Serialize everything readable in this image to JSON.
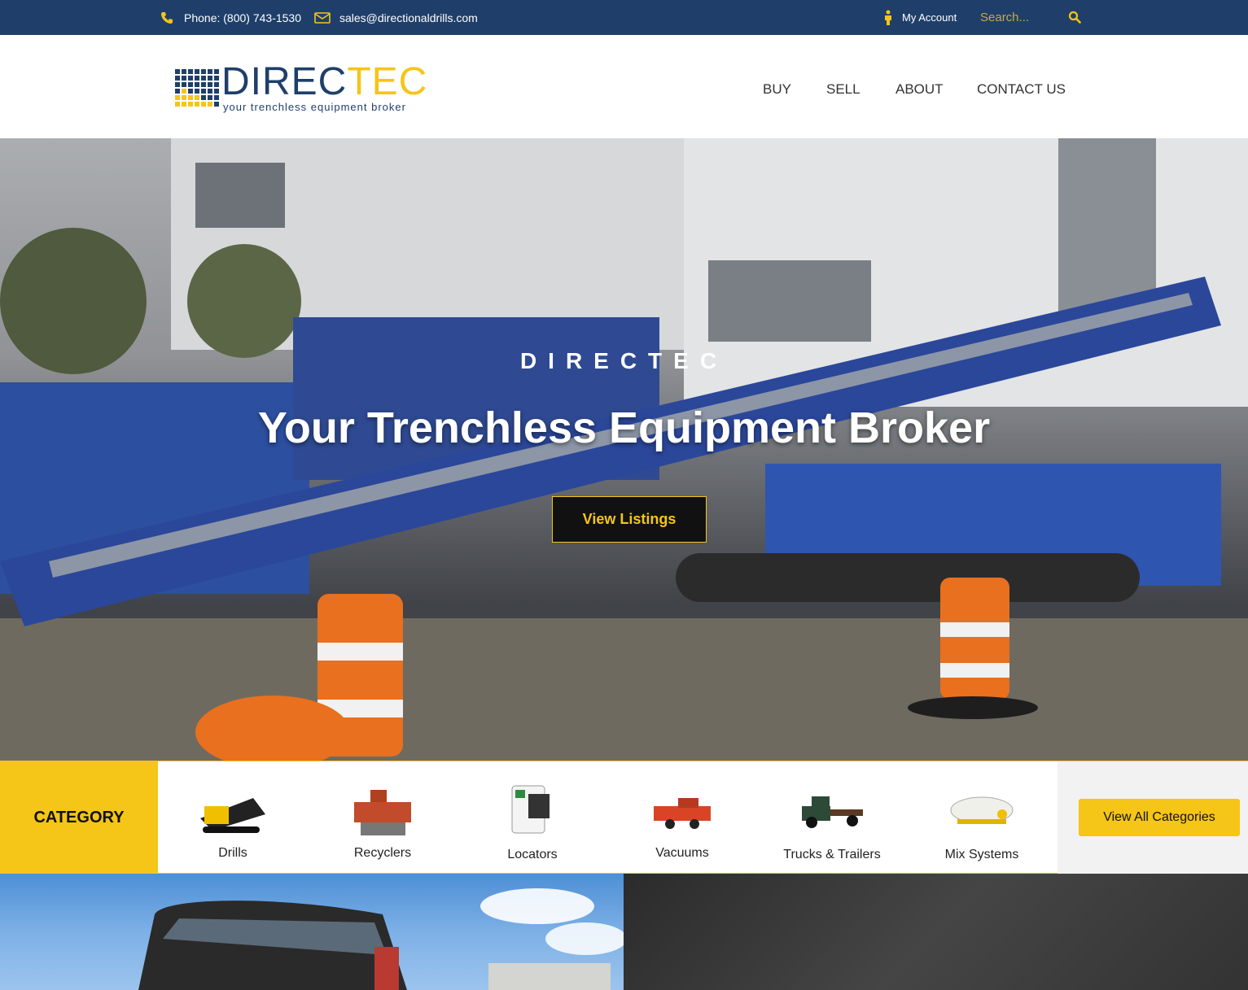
{
  "topbar": {
    "phone": "Phone: (800) 743-1530",
    "email": "sales@directionaldrills.com",
    "account": "My Account",
    "search_placeholder": "Search...",
    "icons": [
      "phone-icon",
      "envelope-icon",
      "user-icon",
      "search-icon"
    ]
  },
  "header": {
    "logo_part1": "DIREC",
    "logo_part2": "TEC",
    "logo_tagline": "your trenchless equipment broker",
    "nav": [
      "BUY",
      "SELL",
      "ABOUT",
      "CONTACT US"
    ]
  },
  "hero": {
    "brand": "DIRECTEC",
    "headline": "Your Trenchless Equipment Broker",
    "cta": "View Listings"
  },
  "categories": {
    "label": "CATEGORY",
    "items": [
      "Drills",
      "Recyclers",
      "Locators",
      "Vacuums",
      "Trucks & Trailers",
      "Mix Systems"
    ],
    "view_all": "View All Categories"
  },
  "colors": {
    "navy": "#1f3f6a",
    "accent": "#f5c518",
    "dark": "#111111"
  }
}
